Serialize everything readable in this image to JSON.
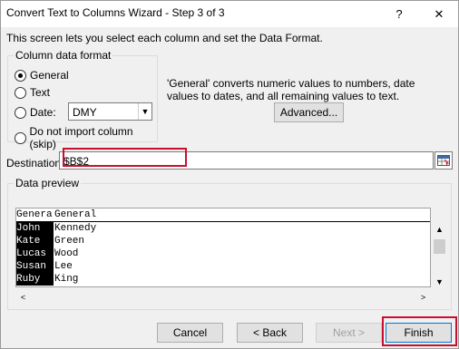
{
  "window": {
    "title": "Convert Text to Columns Wizard - Step 3 of 3",
    "help_label": "?",
    "close_label": "✕"
  },
  "intro_text": "This screen lets you select each column and set the Data Format.",
  "column_format": {
    "group_label": "Column data format",
    "options": [
      {
        "label": "General",
        "selected": true
      },
      {
        "label": "Text",
        "selected": false
      },
      {
        "label": "Date:",
        "selected": false
      },
      {
        "label": "Do not import column (skip)",
        "selected": false
      }
    ],
    "date_value": "DMY"
  },
  "description": "'General' converts numeric values to numbers, date values to dates, and all remaining values to text.",
  "advanced_label": "Advanced...",
  "destination": {
    "label": "Destination:",
    "value": "$B$2"
  },
  "preview": {
    "group_label": "Data preview",
    "headers": [
      "General",
      "General"
    ],
    "rows": [
      [
        "John",
        "Kennedy"
      ],
      [
        "Kate",
        "Green"
      ],
      [
        "Lucas",
        "Wood"
      ],
      [
        "Susan",
        "Lee"
      ],
      [
        "Ruby",
        "King"
      ]
    ]
  },
  "buttons": {
    "cancel": "Cancel",
    "back": "< Back",
    "next": "Next >",
    "finish": "Finish"
  },
  "colors": {
    "highlight": "#c8102e",
    "dialog_bg": "#f0f0f0",
    "accent": "#0078d7"
  }
}
